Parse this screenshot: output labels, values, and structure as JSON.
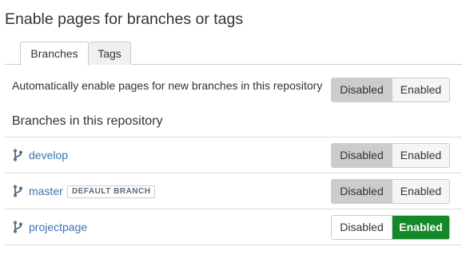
{
  "title": "Enable pages for branches or tags",
  "tabs": [
    {
      "label": "Branches"
    },
    {
      "label": "Tags"
    }
  ],
  "auto_enable": {
    "label": "Automatically enable pages for new branches in this repository",
    "disabled_label": "Disabled",
    "enabled_label": "Enabled",
    "state": "Disabled"
  },
  "branches_heading": "Branches in this repository",
  "branches": [
    {
      "name": "develop",
      "badge": "",
      "disabled_label": "Disabled",
      "enabled_label": "Enabled",
      "state": "Disabled"
    },
    {
      "name": "master",
      "badge": "DEFAULT BRANCH",
      "disabled_label": "Disabled",
      "enabled_label": "Enabled",
      "state": "Disabled"
    },
    {
      "name": "projectpage",
      "badge": "",
      "disabled_label": "Disabled",
      "enabled_label": "Enabled",
      "state": "Enabled"
    }
  ],
  "colors": {
    "link": "#3b73af",
    "enabled_active": "#14892c",
    "selected_grey": "#cccccc"
  },
  "icons": {
    "branch": "branch-icon"
  }
}
